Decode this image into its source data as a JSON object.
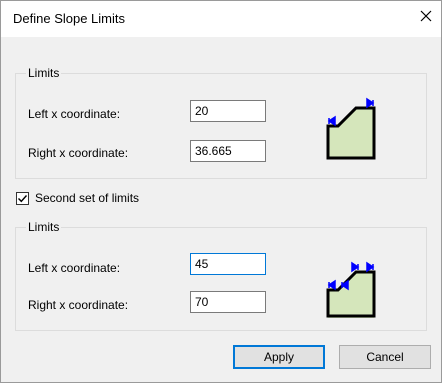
{
  "dialog": {
    "title": "Define Slope Limits",
    "close_icon": "close-icon"
  },
  "group1": {
    "label": "Limits",
    "left_label": "Left x coordinate:",
    "left_value": "20",
    "right_label": "Right x coordinate:",
    "right_value": "36.665",
    "diagram_icon": "slope-single-limit-icon"
  },
  "second_set": {
    "label": "Second set of limits",
    "checked": true
  },
  "group2": {
    "label": "Limits",
    "left_label": "Left x coordinate:",
    "left_value": "45",
    "right_label": "Right x coordinate:",
    "right_value": "70",
    "diagram_icon": "slope-double-limit-icon"
  },
  "buttons": {
    "apply": "Apply",
    "cancel": "Cancel"
  },
  "colors": {
    "slope_fill": "#d5e6bb",
    "marker": "#0000ff",
    "focus": "#0078d7"
  }
}
